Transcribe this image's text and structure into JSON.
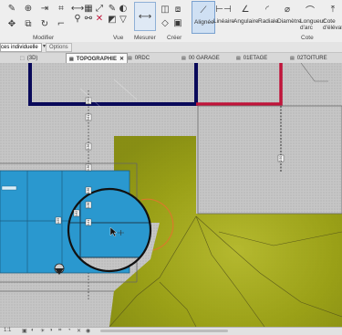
{
  "ribbon": {
    "modify_group_label": "Modifier",
    "view_group_label": "Vue",
    "measure_group_label": "Mesurer",
    "create_group_label": "Créer",
    "cote_group_label": "Cote",
    "cote_tools": [
      {
        "label": "Alignée",
        "icon": "aligned-dimension-icon"
      },
      {
        "label": "Linéaire",
        "icon": "linear-dimension-icon"
      },
      {
        "label": "Angulaire",
        "icon": "angular-dimension-icon"
      },
      {
        "label": "Radiale",
        "icon": "radial-dimension-icon"
      },
      {
        "label": "Diamètre",
        "icon": "diameter-dimension-icon"
      },
      {
        "label": "Longueur d'arc",
        "icon": "arc-length-dimension-icon"
      },
      {
        "label": "Cote d'élévatio",
        "icon": "spot-elevation-icon"
      }
    ]
  },
  "options_bar": {
    "filter_value": "ces individuelle",
    "options_button": "Options"
  },
  "tabs": [
    {
      "label": "(3D)",
      "active": false
    },
    {
      "label": "TOPOGRAPHIE",
      "active": true
    },
    {
      "label": "0RDC",
      "active": false
    },
    {
      "label": "00 GARAGE",
      "active": false
    },
    {
      "label": "01ETAGE",
      "active": false
    },
    {
      "label": "02TOITURE",
      "active": false
    }
  ],
  "canvas": {
    "dim_labels": [
      "2.50",
      "3.61",
      "0.36",
      "0.36",
      "0.36",
      "0.38",
      "0.41",
      "2.50",
      "4.55",
      "0.82"
    ],
    "colors": {
      "terrain": "#9ba11a",
      "pool": "#2a98cf",
      "slab": "#c4c4c4",
      "wall_dark": "#0a0a5a",
      "wall_red": "#c0143a",
      "selection": "#d97b2a"
    }
  },
  "status_bar": {
    "items": [
      "scale-icon",
      "detail-icon",
      "visual-style-icon",
      "sun-icon",
      "shadow-icon",
      "crop-icon",
      "hide-icon",
      "temporary-hide-icon",
      "reveal-icon"
    ]
  }
}
